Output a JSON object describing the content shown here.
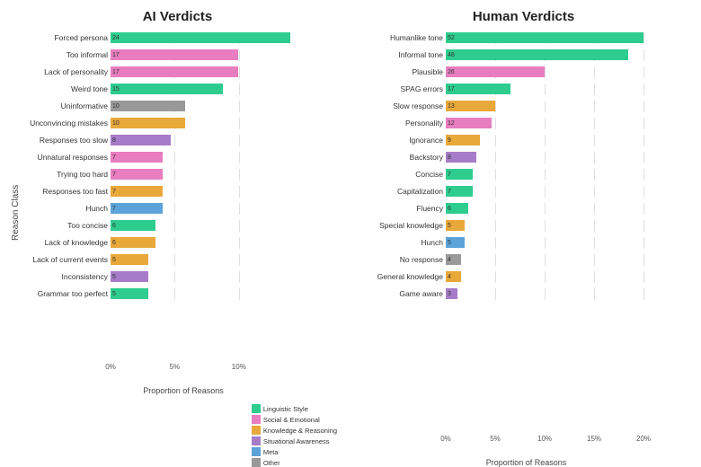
{
  "title_left": "AI Verdicts",
  "title_right": "Human Verdicts",
  "y_axis_label": "Reason Class",
  "x_axis_label": "Proportion of Reasons",
  "colors": {
    "linguistic": "#2ecc8e",
    "social": "#e87dc0",
    "knowledge": "#e8a83a",
    "situational": "#a67cc8",
    "meta": "#5ba3d9",
    "other": "#999999"
  },
  "legend": [
    {
      "label": "Linguistic Style",
      "color": "#2ecc8e"
    },
    {
      "label": "Social & Emotional",
      "color": "#e87dc0"
    },
    {
      "label": "Knowledge & Reasoning",
      "color": "#e8a83a"
    },
    {
      "label": "Situational Awareness",
      "color": "#a67cc8"
    },
    {
      "label": "Meta",
      "color": "#5ba3d9"
    },
    {
      "label": "Other",
      "color": "#999999"
    }
  ],
  "ai_chart": {
    "label_width": 100,
    "max_value": 14,
    "max_pct": 14,
    "x_ticks": [
      "0%",
      "5%",
      "10%"
    ],
    "x_tick_positions": [
      0,
      35.7,
      71.4
    ],
    "bars": [
      {
        "label": "Forced persona",
        "value": 24,
        "color": "#2ecc8e",
        "width_pct": 100
      },
      {
        "label": "Too informal",
        "value": 17,
        "color": "#e87dc0",
        "width_pct": 70.8
      },
      {
        "label": "Lack of personality",
        "value": 17,
        "color": "#e87dc0",
        "width_pct": 70.8
      },
      {
        "label": "Weird tone",
        "value": 15,
        "color": "#2ecc8e",
        "width_pct": 62.5
      },
      {
        "label": "Uninformative",
        "value": 10,
        "color": "#999999",
        "width_pct": 41.7
      },
      {
        "label": "Unconvincing mistakes",
        "value": 10,
        "color": "#e8a83a",
        "width_pct": 41.7
      },
      {
        "label": "Responses too slow",
        "value": 8,
        "color": "#a67cc8",
        "width_pct": 33.3
      },
      {
        "label": "Unnatural responses",
        "value": 7,
        "color": "#e87dc0",
        "width_pct": 29.2
      },
      {
        "label": "Trying too hard",
        "value": 7,
        "color": "#e87dc0",
        "width_pct": 29.2
      },
      {
        "label": "Responses too fast",
        "value": 7,
        "color": "#e8a83a",
        "width_pct": 29.2
      },
      {
        "label": "Hunch",
        "value": 7,
        "color": "#5ba3d9",
        "width_pct": 29.2
      },
      {
        "label": "Too concise",
        "value": 6,
        "color": "#2ecc8e",
        "width_pct": 25
      },
      {
        "label": "Lack of knowledge",
        "value": 6,
        "color": "#e8a83a",
        "width_pct": 25
      },
      {
        "label": "Lack of current events",
        "value": 5,
        "color": "#e8a83a",
        "width_pct": 20.8
      },
      {
        "label": "Inconsistency",
        "value": 5,
        "color": "#a67cc8",
        "width_pct": 20.8
      },
      {
        "label": "Grammar too perfect",
        "value": 5,
        "color": "#2ecc8e",
        "width_pct": 20.8
      }
    ]
  },
  "human_chart": {
    "label_width": 95,
    "max_value": 26,
    "max_pct": 20,
    "x_ticks": [
      "0%",
      "5%",
      "10%",
      "15%",
      "20%"
    ],
    "x_tick_positions": [
      0,
      25,
      50,
      75,
      100
    ],
    "bars": [
      {
        "label": "Humanlike tone",
        "value": 52,
        "color": "#2ecc8e",
        "width_pct": 100
      },
      {
        "label": "Informal tone",
        "value": 48,
        "color": "#2ecc8e",
        "width_pct": 92.3
      },
      {
        "label": "Plausible",
        "value": 26,
        "color": "#e87dc0",
        "width_pct": 50
      },
      {
        "label": "SPAG errors",
        "value": 17,
        "color": "#2ecc8e",
        "width_pct": 32.7
      },
      {
        "label": "Slow response",
        "value": 13,
        "color": "#e8a83a",
        "width_pct": 25
      },
      {
        "label": "Personality",
        "value": 12,
        "color": "#e87dc0",
        "width_pct": 23.1
      },
      {
        "label": "Ignorance",
        "value": 9,
        "color": "#e8a83a",
        "width_pct": 17.3
      },
      {
        "label": "Backstory",
        "value": 8,
        "color": "#a67cc8",
        "width_pct": 15.4
      },
      {
        "label": "Concise",
        "value": 7,
        "color": "#2ecc8e",
        "width_pct": 13.5
      },
      {
        "label": "Capitalization",
        "value": 7,
        "color": "#2ecc8e",
        "width_pct": 13.5
      },
      {
        "label": "Fluency",
        "value": 6,
        "color": "#2ecc8e",
        "width_pct": 11.5
      },
      {
        "label": "Special knowledge",
        "value": 5,
        "color": "#e8a83a",
        "width_pct": 9.6
      },
      {
        "label": "Hunch",
        "value": 5,
        "color": "#5ba3d9",
        "width_pct": 9.6
      },
      {
        "label": "No response",
        "value": 4,
        "color": "#999999",
        "width_pct": 7.7
      },
      {
        "label": "General knowledge",
        "value": 4,
        "color": "#e8a83a",
        "width_pct": 7.7
      },
      {
        "label": "Game aware",
        "value": 3,
        "color": "#a67cc8",
        "width_pct": 5.8
      }
    ]
  }
}
